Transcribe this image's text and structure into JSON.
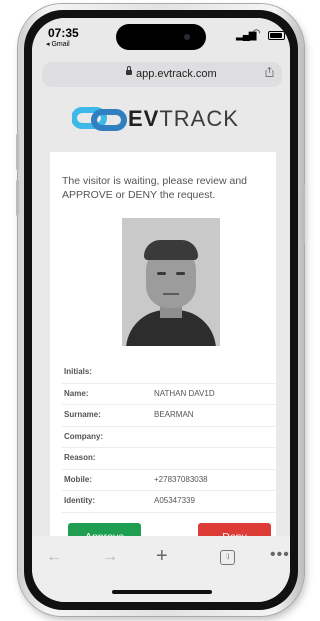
{
  "status_bar": {
    "time": "07:35",
    "back_app": "◂ Gmail"
  },
  "browser": {
    "url": "app.evtrack.com",
    "toolbar": {
      "back": "←",
      "forward": "→",
      "new_tab": "+",
      "tabs": ":)",
      "more": "•••"
    }
  },
  "logo": {
    "text_bold": "EV",
    "text_light": "TRACK",
    "color_blue": "#3db8e8",
    "color_grey": "#3b3b3b"
  },
  "prompt": "The visitor is waiting, please review and APPROVE or DENY the request.",
  "fields": [
    {
      "label": "Initials:",
      "value": ""
    },
    {
      "label": "Name:",
      "value": "NATHAN DAV1D"
    },
    {
      "label": "Surname:",
      "value": "BEARMAN"
    },
    {
      "label": "Company:",
      "value": ""
    },
    {
      "label": "Reason:",
      "value": ""
    },
    {
      "label": "Mobile:",
      "value": "+27837083038"
    },
    {
      "label": "Identity:",
      "value": "A05347339"
    }
  ],
  "actions": {
    "approve": "Approve",
    "deny": "Deny",
    "approve_color": "#1f9e51",
    "deny_color": "#dc3b36"
  }
}
